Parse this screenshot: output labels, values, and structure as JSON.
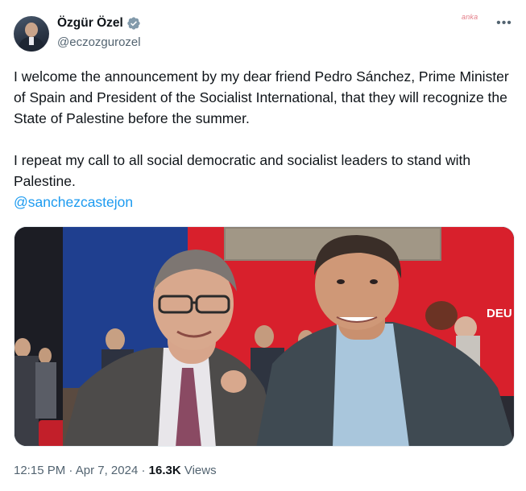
{
  "author": {
    "display_name": "Özgür Özel",
    "handle": "@eczozgurozel",
    "verified": true
  },
  "watermark": "anka",
  "tweet": {
    "paragraph_1": "I welcome the announcement by my dear friend Pedro Sánchez, Prime Minister of Spain and President of the Socialist International, that they will recognize the State of Palestine before the summer.",
    "paragraph_2": "I repeat my call to all social democratic and socialist leaders to stand with Palestine.",
    "mention": "@sanchezcastejon"
  },
  "photo": {
    "backdrop_text": "DEU",
    "colors": {
      "red_wall": "#d8202c",
      "blue_wall": "#1f3f8f"
    }
  },
  "meta": {
    "time": "12:15 PM",
    "separator": "·",
    "date": "Apr 7, 2024",
    "views_count": "16.3K",
    "views_label": "Views"
  },
  "icons": {
    "verified": "verified-badge-icon",
    "more": "more-options-icon"
  },
  "colors": {
    "link": "#1d9bf0",
    "secondary_text": "#536471",
    "primary_text": "#0f1419"
  }
}
